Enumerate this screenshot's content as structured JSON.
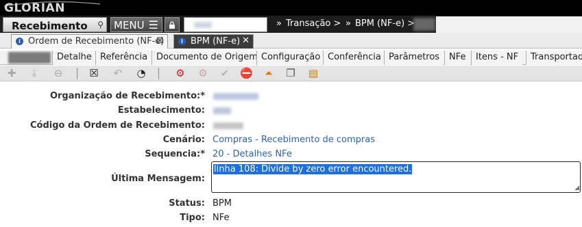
{
  "app": {
    "logo": "GLORIAN"
  },
  "header": {
    "module_title": "Recebimento",
    "menu_label": "MENU",
    "breadcrumb": [
      "Transação >",
      "BPM (NF-e) >"
    ]
  },
  "doc_tabs": [
    {
      "label": "Ordem de Recebimento (NF-e)",
      "active": false
    },
    {
      "label": "BPM (NF-e)",
      "active": true
    }
  ],
  "sub_tabs": [
    "Detalhe",
    "Referência",
    "Documento de Origem",
    "Configuração",
    "Conferência",
    "Parâmetros",
    "NFe",
    "Itens - NF",
    "Transportador"
  ],
  "form": {
    "org_label": "Organização de Recebimento:*",
    "estab_label": "Estabelecimento:",
    "codigo_label": "Código da Ordem de Recebimento:",
    "cenario_label": "Cenário:",
    "cenario_value": "Compras - Recebimento de compras",
    "sequencia_label": "Sequencia:*",
    "sequencia_value": "20 - Detalhes NFe",
    "ultima_label": "Última Mensagem:",
    "ultima_value": "linha 108: Divide by zero error encountered.",
    "status_label": "Status:",
    "status_value": "BPM",
    "tipo_label": "Tipo:",
    "tipo_value": "NFe"
  },
  "colors": {
    "link": "#2f63b5",
    "selection": "#1e6fe0",
    "topbar": "#000000"
  }
}
